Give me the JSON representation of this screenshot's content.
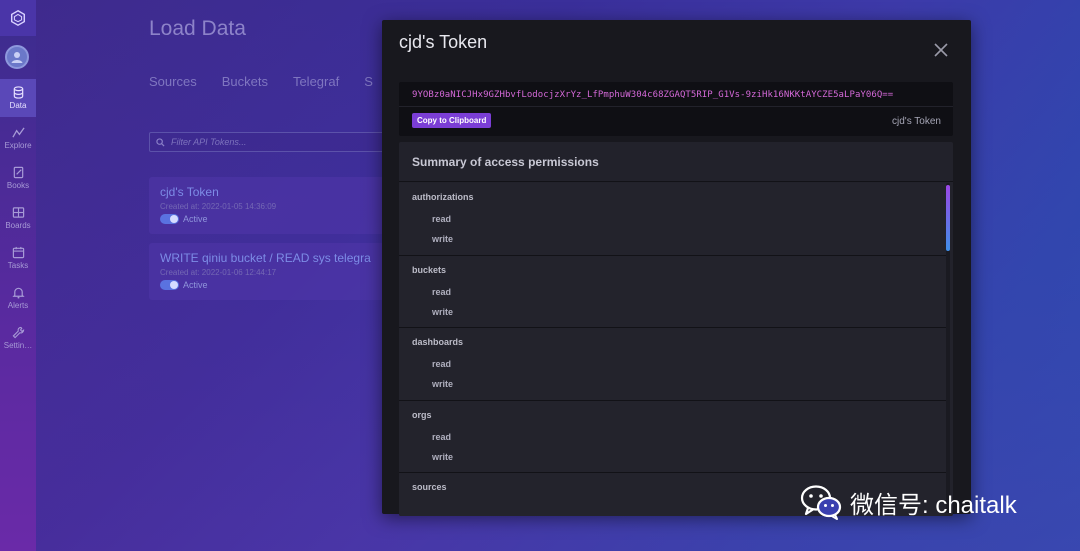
{
  "sidebar": {
    "items": [
      {
        "label": "Data",
        "icon": "database-icon",
        "active": true
      },
      {
        "label": "Explore",
        "icon": "graph-icon",
        "active": false
      },
      {
        "label": "Books",
        "icon": "notebook-icon",
        "active": false
      },
      {
        "label": "Boards",
        "icon": "dashboard-icon",
        "active": false
      },
      {
        "label": "Tasks",
        "icon": "calendar-icon",
        "active": false
      },
      {
        "label": "Alerts",
        "icon": "bell-icon",
        "active": false
      },
      {
        "label": "Settin…",
        "icon": "wrench-icon",
        "active": false
      }
    ]
  },
  "page": {
    "title": "Load Data",
    "tabs": [
      "Sources",
      "Buckets",
      "Telegraf",
      "S"
    ],
    "filter_placeholder": "Filter API Tokens...",
    "tokens": [
      {
        "name": "cjd's Token",
        "created": "Created at: 2022-01-05 14:36:09",
        "status": "Active"
      },
      {
        "name": "WRITE qiniu bucket / READ sys telegra",
        "created": "Created at: 2022-01-06 12:44:17",
        "status": "Active"
      }
    ]
  },
  "modal": {
    "title": "cjd's Token",
    "token_value": "9YOBz0aNICJHx9GZHbvfLodocjzXrYz_LfPmphuW304c68ZGAQT5RIP_G1Vs-9ziHk16NKKtAYCZE5aLPaY06Q==",
    "copy_label": "Copy to Clipboard",
    "token_description": "cjd's Token",
    "permissions_header": "Summary of access permissions",
    "permissions": [
      {
        "resource": "authorizations",
        "actions": [
          "read",
          "write"
        ]
      },
      {
        "resource": "buckets",
        "actions": [
          "read",
          "write"
        ]
      },
      {
        "resource": "dashboards",
        "actions": [
          "read",
          "write"
        ]
      },
      {
        "resource": "orgs",
        "actions": [
          "read",
          "write"
        ]
      },
      {
        "resource": "sources",
        "actions": []
      }
    ]
  },
  "watermark": {
    "text": "微信号: chaitalk"
  },
  "colors": {
    "accent": "#7b3ed6",
    "token_text": "#d469d8",
    "modal_bg": "#18181e"
  }
}
